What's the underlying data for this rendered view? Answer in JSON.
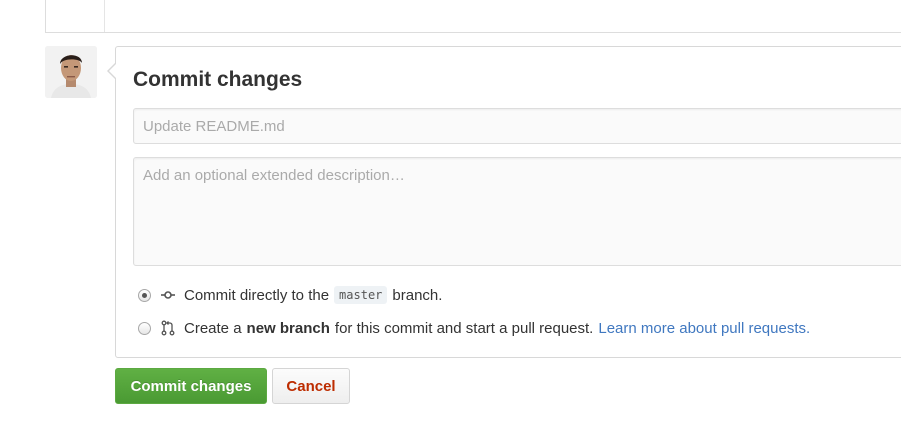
{
  "commit_form": {
    "title": "Commit changes",
    "summary_value": "",
    "summary_placeholder": "Update README.md",
    "description_value": "",
    "description_placeholder": "Add an optional extended description…"
  },
  "options": {
    "direct": {
      "checked": true,
      "icon": "git-commit-icon",
      "text_before": "Commit directly to the",
      "branch_name": "master",
      "text_after": "branch."
    },
    "new_branch": {
      "checked": false,
      "icon": "git-pull-request-icon",
      "text_before": "Create a",
      "bold_text": "new branch",
      "text_after": "for this commit and start a pull request.",
      "link_text": "Learn more about pull requests."
    }
  },
  "buttons": {
    "commit_label": "Commit changes",
    "cancel_label": "Cancel"
  },
  "colors": {
    "primary_green": "#55a532",
    "cancel_red": "#bd2c00",
    "link_blue": "#4078c0"
  }
}
